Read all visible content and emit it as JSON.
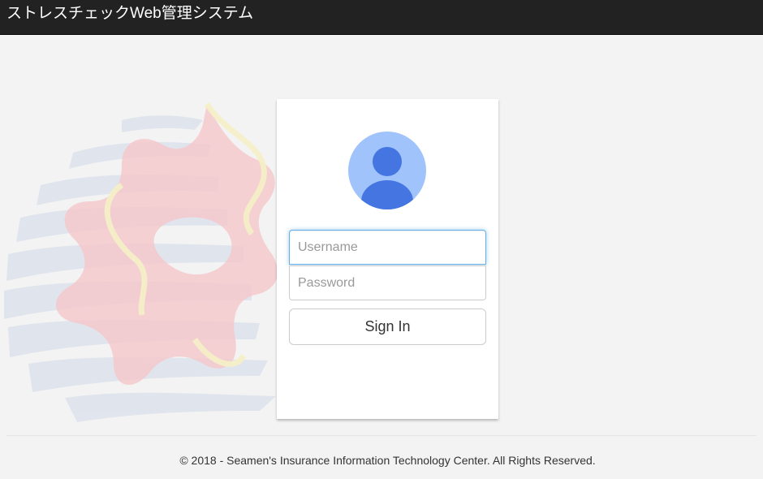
{
  "header": {
    "title": "ストレスチェックWeb管理システム"
  },
  "login": {
    "username_placeholder": "Username",
    "password_placeholder": "Password",
    "sign_in_label": "Sign In"
  },
  "footer": {
    "copyright": "© 2018 - Seamen's Insurance Information Technology Center. All Rights Reserved."
  },
  "colors": {
    "header_bg": "#222222",
    "avatar_bg": "#a0c3fb",
    "avatar_fg": "#4475e1",
    "focus_border": "#66afe9"
  },
  "icons": {
    "avatar": "user-avatar-icon",
    "background": "wave-star-logo-watermark"
  }
}
